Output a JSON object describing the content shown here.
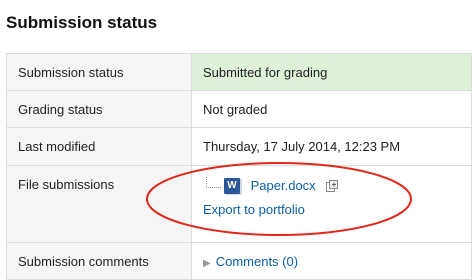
{
  "section": {
    "title": "Submission status"
  },
  "rows": {
    "submission_status": {
      "label": "Submission status",
      "value": "Submitted for grading"
    },
    "grading_status": {
      "label": "Grading status",
      "value": "Not graded"
    },
    "last_modified": {
      "label": "Last modified",
      "value": "Thursday, 17 July 2014, 12:23 PM"
    },
    "file_submissions": {
      "label": "File submissions",
      "file_name": "Paper.docx",
      "file_icon": "word-document-icon",
      "portfolio_icon": "add-to-portfolio-icon",
      "export_link": "Export to portfolio"
    },
    "submission_comments": {
      "label": "Submission comments",
      "toggle_icon": "triangle-right-icon",
      "link": "Comments (0)"
    }
  },
  "colors": {
    "submitted_bg": "#dff0d8",
    "link": "#0b5fa5",
    "highlight_ellipse": "#e0281b"
  }
}
